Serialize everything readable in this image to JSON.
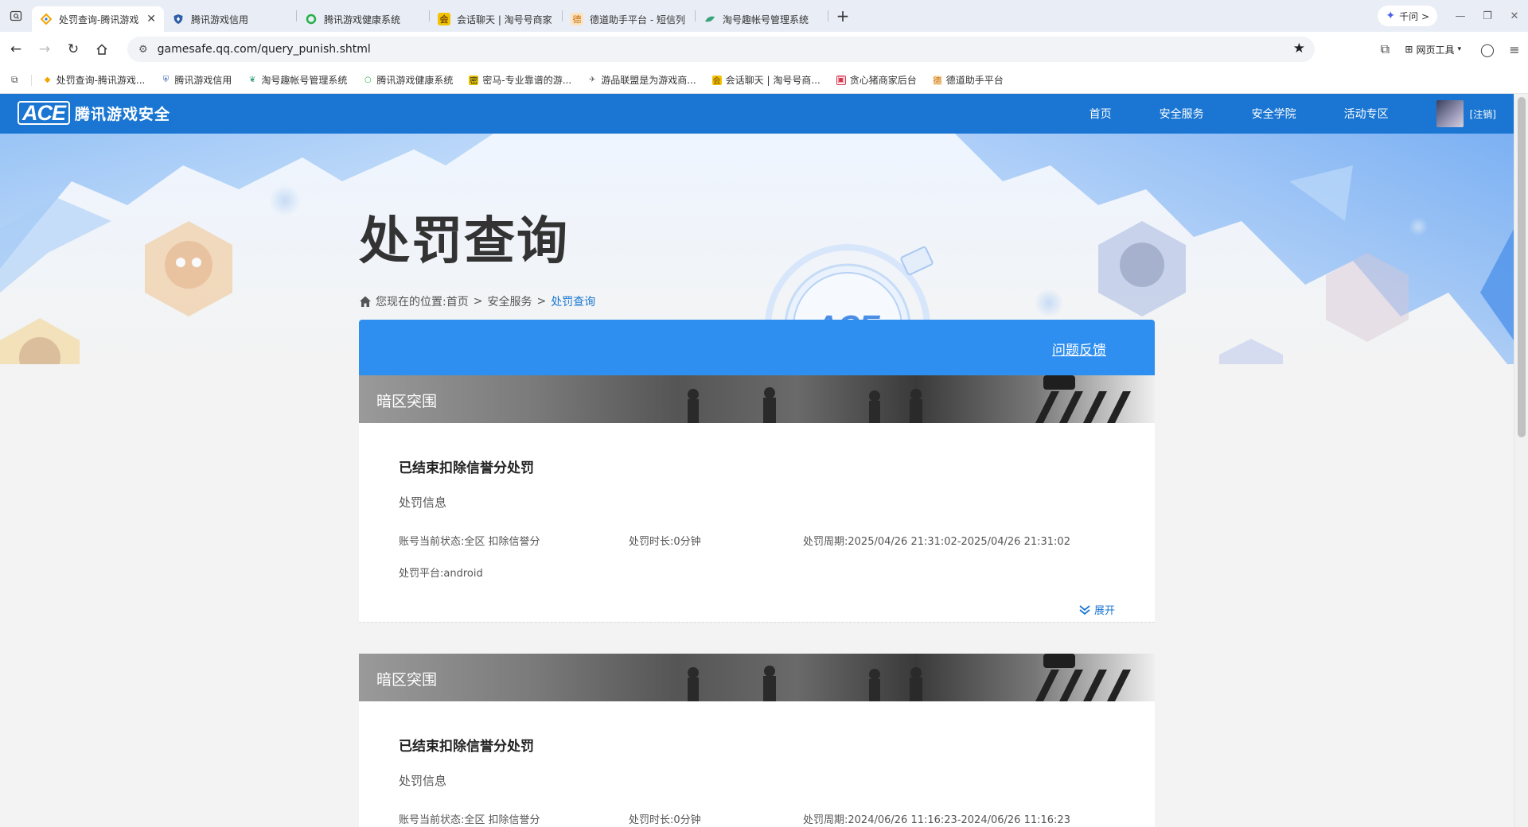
{
  "browser": {
    "tabs": [
      {
        "label": "处罚查询-腾讯游戏",
        "active": true,
        "icon": "ace-diamond-icon",
        "color": "#f5a300"
      },
      {
        "label": "腾讯游戏信用",
        "active": false,
        "icon": "shield-icon",
        "color": "#2d5fa8"
      },
      {
        "label": "腾讯游戏健康系统",
        "active": false,
        "icon": "green-ring-icon",
        "color": "#24b14a"
      },
      {
        "label": "会话聊天 | 淘号号商家",
        "active": false,
        "icon": "chat-yellow-icon",
        "color": "#f2c300"
      },
      {
        "label": "德道助手平台 - 短信列",
        "active": false,
        "icon": "assistant-icon",
        "color": "#e8a23a"
      },
      {
        "label": "淘号趣帐号管理系统",
        "active": false,
        "icon": "leaf-icon",
        "color": "#3aa37c"
      }
    ],
    "new_tab": "+",
    "qianwen_label": "千问 >",
    "url": "gamesafe.qq.com/query_punish.shtml",
    "tools_label": "网页工具",
    "bookmarks": [
      {
        "label": "处罚查询-腾讯游戏...",
        "icon": "ace-diamond-icon",
        "color": "#f5a300"
      },
      {
        "label": "腾讯游戏信用",
        "icon": "shield-icon",
        "color": "#2d5fa8"
      },
      {
        "label": "淘号趣帐号管理系统",
        "icon": "leaf-icon",
        "color": "#3aa37c"
      },
      {
        "label": "腾讯游戏健康系统",
        "icon": "green-ring-icon",
        "color": "#24b14a"
      },
      {
        "label": "密马-专业靠谱的游...",
        "icon": "mima-icon",
        "color": "#e6c200"
      },
      {
        "label": "游品联盟是为游戏商...",
        "icon": "plane-icon",
        "color": "#666666"
      },
      {
        "label": "会话聊天 | 淘号号商...",
        "icon": "chat-yellow-icon",
        "color": "#f2c300"
      },
      {
        "label": "贪心猪商家后台",
        "icon": "pig-icon",
        "color": "#d9334a"
      },
      {
        "label": "德道助手平台",
        "icon": "assistant-icon",
        "color": "#e8a23a"
      }
    ]
  },
  "site": {
    "logo_ace": "ACE",
    "logo_text": "腾讯游戏安全",
    "nav": [
      "首页",
      "安全服务",
      "安全学院",
      "活动专区"
    ],
    "logout": "[注销]",
    "brand_color": "#1a76d2"
  },
  "page": {
    "title": "处罚查询",
    "breadcrumb": {
      "prefix": "您现在的位置:",
      "items": [
        "首页",
        "安全服务"
      ],
      "current": "处罚查询"
    },
    "feedback": "问题反馈",
    "feedback_color": "#2f8ff0",
    "records": [
      {
        "game": "暗区突围",
        "title": "已结束扣除信誉分处罚",
        "subtitle": "处罚信息",
        "status": "账号当前状态:全区 扣除信誉分",
        "duration": "处罚时长:0分钟",
        "period": "处罚周期:2025/04/26 21:31:02-2025/04/26 21:31:02",
        "platform": "处罚平台:android",
        "expand": "展开"
      },
      {
        "game": "暗区突围",
        "title": "已结束扣除信誉分处罚",
        "subtitle": "处罚信息",
        "status": "账号当前状态:全区 扣除信誉分",
        "duration": "处罚时长:0分钟",
        "period": "处罚周期:2024/06/26 11:16:23-2024/06/26 11:16:23"
      }
    ]
  }
}
